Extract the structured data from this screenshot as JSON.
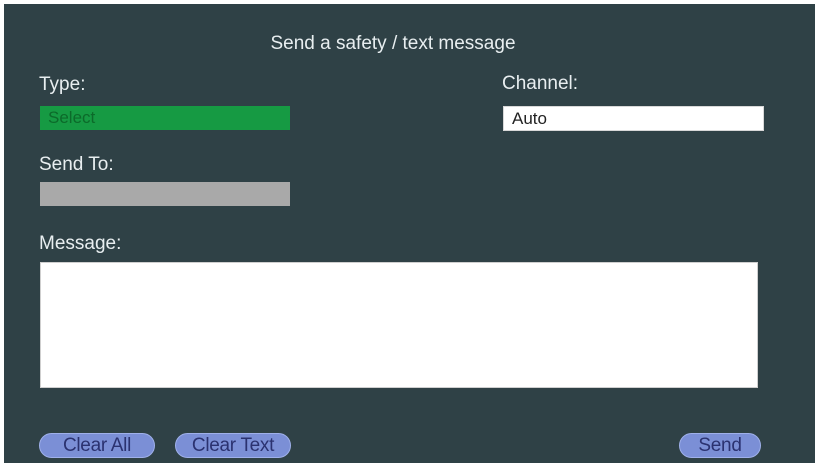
{
  "dialog": {
    "title": "Send a safety / text message"
  },
  "type": {
    "label": "Type:",
    "value": "Select"
  },
  "channel": {
    "label": "Channel:",
    "value": "Auto"
  },
  "send_to": {
    "label": "Send To:",
    "value": ""
  },
  "message": {
    "label": "Message:",
    "value": ""
  },
  "buttons": {
    "clear_all": "Clear All",
    "clear_text": "Clear Text",
    "send": "Send"
  },
  "colors": {
    "background": "#2f4146",
    "type_select": "#169a43",
    "send_to_field": "#a9a9a9",
    "button": "#7b8fd6"
  }
}
